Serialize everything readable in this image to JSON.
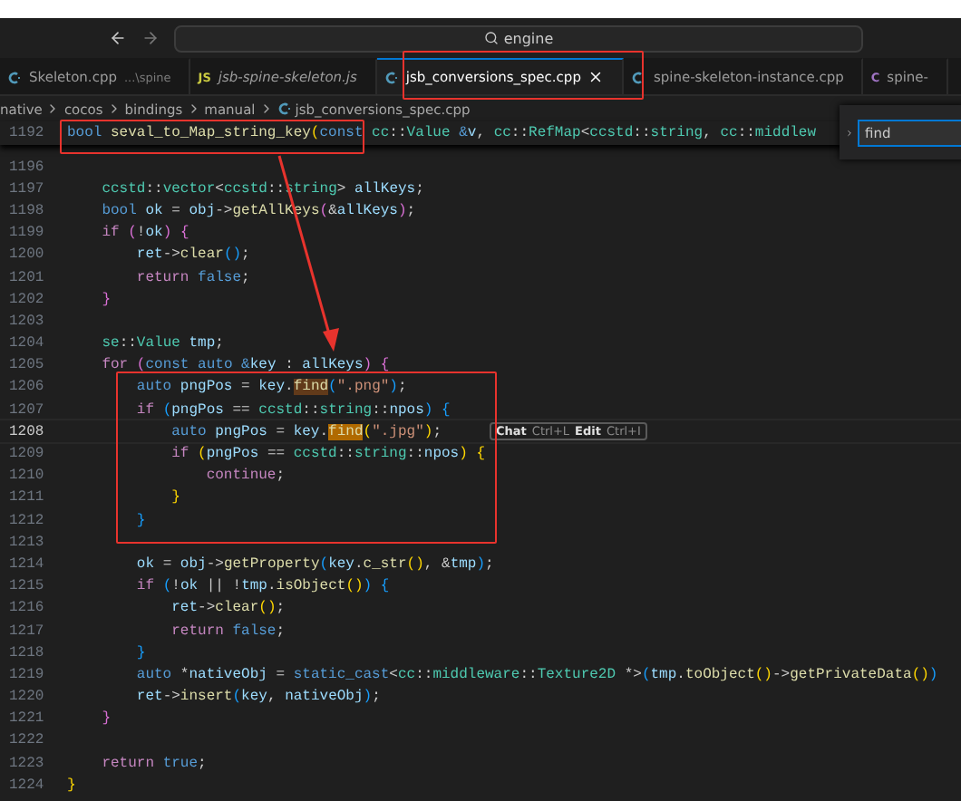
{
  "titlebar": {
    "search": "engine"
  },
  "tabs": [
    {
      "label": "Skeleton.cpp",
      "description": "...\\spine",
      "kind": "cpp",
      "selected": false,
      "italic": false
    },
    {
      "label": "jsb-spine-skeleton.js",
      "kind": "js",
      "badge": "JS",
      "selected": false,
      "italic": true
    },
    {
      "label": "jsb_conversions_spec.cpp",
      "kind": "cpp",
      "selected": true,
      "italic": false
    },
    {
      "label": "spine-skeleton-instance.cpp",
      "kind": "cpp",
      "selected": false,
      "italic": false
    },
    {
      "label": "spine-",
      "kind": "c",
      "badge": "C",
      "selected": false,
      "italic": false
    }
  ],
  "breadcrumb": [
    "native",
    "cocos",
    "bindings",
    "manual",
    "jsb_conversions_spec.cpp"
  ],
  "sticky_line": {
    "number": "1192",
    "tokens": [
      {
        "text": "bool",
        "kind": "k"
      },
      {
        "text": " seval_to_Map_string_key",
        "kind": "f"
      },
      {
        "text": "(",
        "kind": "y"
      },
      {
        "text": "const",
        "kind": "k"
      },
      {
        "text": " cc",
        "kind": "t"
      },
      {
        "text": "::",
        "kind": "p"
      },
      {
        "text": "Value",
        "kind": "t"
      },
      {
        "text": " &",
        "kind": "k"
      },
      {
        "text": "v",
        "kind": "v"
      },
      {
        "text": ", ",
        "kind": "p"
      },
      {
        "text": "cc",
        "kind": "t"
      },
      {
        "text": "::",
        "kind": "p"
      },
      {
        "text": "RefMap",
        "kind": "t"
      },
      {
        "text": "<",
        "kind": "p"
      },
      {
        "text": "ccstd",
        "kind": "t"
      },
      {
        "text": "::",
        "kind": "p"
      },
      {
        "text": "string",
        "kind": "t"
      },
      {
        "text": ", ",
        "kind": "p"
      },
      {
        "text": "cc",
        "kind": "t"
      },
      {
        "text": "::",
        "kind": "p"
      },
      {
        "text": "middlew",
        "kind": "t"
      }
    ]
  },
  "find_widget": {
    "value": "find"
  },
  "lines": [
    {
      "number": "1196",
      "current": false
    },
    {
      "number": "1197",
      "current": false,
      "tokens": [
        {
          "text": "    ccstd",
          "kind": "t"
        },
        {
          "text": "::",
          "kind": "p"
        },
        {
          "text": "vector",
          "kind": "t"
        },
        {
          "text": "<",
          "kind": "p"
        },
        {
          "text": "ccstd",
          "kind": "t"
        },
        {
          "text": "::",
          "kind": "p"
        },
        {
          "text": "string",
          "kind": "t"
        },
        {
          "text": "> ",
          "kind": "p"
        },
        {
          "text": "allKeys",
          "kind": "v"
        },
        {
          "text": ";",
          "kind": "p"
        }
      ]
    },
    {
      "number": "1198",
      "current": false,
      "tokens": [
        {
          "text": "    bool",
          "kind": "k"
        },
        {
          "text": " ok",
          "kind": "v"
        },
        {
          "text": " = ",
          "kind": "p"
        },
        {
          "text": "obj",
          "kind": "v"
        },
        {
          "text": "->",
          "kind": "p"
        },
        {
          "text": "getAllKeys",
          "kind": "f"
        },
        {
          "text": "(",
          "kind": "m"
        },
        {
          "text": "&",
          "kind": "p"
        },
        {
          "text": "allKeys",
          "kind": "v"
        },
        {
          "text": ")",
          "kind": "m"
        },
        {
          "text": ";",
          "kind": "p"
        }
      ]
    },
    {
      "number": "1199",
      "current": false,
      "tokens": [
        {
          "text": "    if",
          "kind": "c"
        },
        {
          "text": " (",
          "kind": "m"
        },
        {
          "text": "!",
          "kind": "p"
        },
        {
          "text": "ok",
          "kind": "v"
        },
        {
          "text": ")",
          "kind": "m"
        },
        {
          "text": " {",
          "kind": "m"
        }
      ]
    },
    {
      "number": "1200",
      "current": false,
      "tokens": [
        {
          "text": "        ret",
          "kind": "v"
        },
        {
          "text": "->",
          "kind": "p"
        },
        {
          "text": "clear",
          "kind": "f"
        },
        {
          "text": "()",
          "kind": "b"
        },
        {
          "text": ";",
          "kind": "p"
        }
      ]
    },
    {
      "number": "1201",
      "current": false,
      "tokens": [
        {
          "text": "        return",
          "kind": "c"
        },
        {
          "text": " false",
          "kind": "k"
        },
        {
          "text": ";",
          "kind": "p"
        }
      ]
    },
    {
      "number": "1202",
      "current": false,
      "tokens": [
        {
          "text": "    }",
          "kind": "m"
        }
      ]
    },
    {
      "number": "1203",
      "current": false
    },
    {
      "number": "1204",
      "current": false,
      "tokens": [
        {
          "text": "    se",
          "kind": "t"
        },
        {
          "text": "::",
          "kind": "p"
        },
        {
          "text": "Value",
          "kind": "t"
        },
        {
          "text": " tmp",
          "kind": "v"
        },
        {
          "text": ";",
          "kind": "p"
        }
      ]
    },
    {
      "number": "1205",
      "current": false,
      "tokens": [
        {
          "text": "    for",
          "kind": "c"
        },
        {
          "text": " (",
          "kind": "m"
        },
        {
          "text": "const",
          "kind": "k"
        },
        {
          "text": " auto",
          "kind": "k"
        },
        {
          "text": " &",
          "kind": "k"
        },
        {
          "text": "key",
          "kind": "v"
        },
        {
          "text": " : ",
          "kind": "p"
        },
        {
          "text": "allKeys",
          "kind": "v"
        },
        {
          "text": ")",
          "kind": "m"
        },
        {
          "text": " {",
          "kind": "m"
        }
      ]
    },
    {
      "number": "1206",
      "current": false,
      "tokens": [
        {
          "text": "        auto",
          "kind": "k"
        },
        {
          "text": " pngPos",
          "kind": "v"
        },
        {
          "text": " = ",
          "kind": "p"
        },
        {
          "text": "key",
          "kind": "v"
        },
        {
          "text": ".",
          "kind": "p"
        },
        {
          "text": "find",
          "kind": "hm"
        },
        {
          "text": "(",
          "kind": "b"
        },
        {
          "text": "\".png\"",
          "kind": "s"
        },
        {
          "text": ")",
          "kind": "b"
        },
        {
          "text": ";",
          "kind": "p"
        }
      ]
    },
    {
      "number": "1207",
      "current": false,
      "tokens": [
        {
          "text": "        if",
          "kind": "c"
        },
        {
          "text": " (",
          "kind": "b"
        },
        {
          "text": "pngPos",
          "kind": "v"
        },
        {
          "text": " == ",
          "kind": "p"
        },
        {
          "text": "ccstd",
          "kind": "t"
        },
        {
          "text": "::",
          "kind": "p"
        },
        {
          "text": "string",
          "kind": "t"
        },
        {
          "text": "::",
          "kind": "p"
        },
        {
          "text": "npos",
          "kind": "v"
        },
        {
          "text": ")",
          "kind": "b"
        },
        {
          "text": " {",
          "kind": "b"
        }
      ]
    },
    {
      "number": "1208",
      "current": true,
      "hint": [
        {
          "text": "Chat",
          "bold": true
        },
        {
          "text": "Ctrl+L",
          "bold": false
        },
        {
          "text": "Edit",
          "bold": true
        },
        {
          "text": "Ctrl+I",
          "bold": false
        }
      ],
      "tokens": [
        {
          "text": "            auto",
          "kind": "k"
        },
        {
          "text": " pngPos",
          "kind": "v"
        },
        {
          "text": " = ",
          "kind": "p"
        },
        {
          "text": "key",
          "kind": "v"
        },
        {
          "text": ".",
          "kind": "p"
        },
        {
          "text": "find",
          "kind": "hc"
        },
        {
          "text": "(",
          "kind": "y"
        },
        {
          "text": "\".jpg\"",
          "kind": "s"
        },
        {
          "text": ")",
          "kind": "y"
        },
        {
          "text": ";",
          "kind": "p"
        }
      ]
    },
    {
      "number": "1209",
      "current": false,
      "tokens": [
        {
          "text": "            if",
          "kind": "c"
        },
        {
          "text": " (",
          "kind": "y"
        },
        {
          "text": "pngPos",
          "kind": "v"
        },
        {
          "text": " == ",
          "kind": "p"
        },
        {
          "text": "ccstd",
          "kind": "t"
        },
        {
          "text": "::",
          "kind": "p"
        },
        {
          "text": "string",
          "kind": "t"
        },
        {
          "text": "::",
          "kind": "p"
        },
        {
          "text": "npos",
          "kind": "v"
        },
        {
          "text": ")",
          "kind": "y"
        },
        {
          "text": " {",
          "kind": "y"
        }
      ]
    },
    {
      "number": "1210",
      "current": false,
      "tokens": [
        {
          "text": "                continue",
          "kind": "c"
        },
        {
          "text": ";",
          "kind": "p"
        }
      ]
    },
    {
      "number": "1211",
      "current": false,
      "tokens": [
        {
          "text": "            }",
          "kind": "y"
        }
      ]
    },
    {
      "number": "1212",
      "current": false,
      "tokens": [
        {
          "text": "        }",
          "kind": "b"
        }
      ]
    },
    {
      "number": "1213",
      "current": false
    },
    {
      "number": "1214",
      "current": false,
      "tokens": [
        {
          "text": "        ok",
          "kind": "v"
        },
        {
          "text": " = ",
          "kind": "p"
        },
        {
          "text": "obj",
          "kind": "v"
        },
        {
          "text": "->",
          "kind": "p"
        },
        {
          "text": "getProperty",
          "kind": "f"
        },
        {
          "text": "(",
          "kind": "b"
        },
        {
          "text": "key",
          "kind": "v"
        },
        {
          "text": ".",
          "kind": "p"
        },
        {
          "text": "c_str",
          "kind": "f"
        },
        {
          "text": "()",
          "kind": "y"
        },
        {
          "text": ", &",
          "kind": "p"
        },
        {
          "text": "tmp",
          "kind": "v"
        },
        {
          "text": ")",
          "kind": "b"
        },
        {
          "text": ";",
          "kind": "p"
        }
      ]
    },
    {
      "number": "1215",
      "current": false,
      "tokens": [
        {
          "text": "        if",
          "kind": "c"
        },
        {
          "text": " (",
          "kind": "b"
        },
        {
          "text": "!",
          "kind": "p"
        },
        {
          "text": "ok",
          "kind": "v"
        },
        {
          "text": " || !",
          "kind": "p"
        },
        {
          "text": "tmp",
          "kind": "v"
        },
        {
          "text": ".",
          "kind": "p"
        },
        {
          "text": "isObject",
          "kind": "f"
        },
        {
          "text": "()",
          "kind": "y"
        },
        {
          "text": ")",
          "kind": "b"
        },
        {
          "text": " {",
          "kind": "b"
        }
      ]
    },
    {
      "number": "1216",
      "current": false,
      "tokens": [
        {
          "text": "            ret",
          "kind": "v"
        },
        {
          "text": "->",
          "kind": "p"
        },
        {
          "text": "clear",
          "kind": "f"
        },
        {
          "text": "()",
          "kind": "y"
        },
        {
          "text": ";",
          "kind": "p"
        }
      ]
    },
    {
      "number": "1217",
      "current": false,
      "tokens": [
        {
          "text": "            return",
          "kind": "c"
        },
        {
          "text": " false",
          "kind": "k"
        },
        {
          "text": ";",
          "kind": "p"
        }
      ]
    },
    {
      "number": "1218",
      "current": false,
      "tokens": [
        {
          "text": "        }",
          "kind": "b"
        }
      ]
    },
    {
      "number": "1219",
      "current": false,
      "tokens": [
        {
          "text": "        auto",
          "kind": "k"
        },
        {
          "text": " *",
          "kind": "p"
        },
        {
          "text": "nativeObj",
          "kind": "v"
        },
        {
          "text": " = ",
          "kind": "p"
        },
        {
          "text": "static_cast",
          "kind": "k"
        },
        {
          "text": "<",
          "kind": "p"
        },
        {
          "text": "cc",
          "kind": "t"
        },
        {
          "text": "::",
          "kind": "p"
        },
        {
          "text": "middleware",
          "kind": "t"
        },
        {
          "text": "::",
          "kind": "p"
        },
        {
          "text": "Texture2D",
          "kind": "t"
        },
        {
          "text": " *>",
          "kind": "p"
        },
        {
          "text": "(",
          "kind": "b"
        },
        {
          "text": "tmp",
          "kind": "v"
        },
        {
          "text": ".",
          "kind": "p"
        },
        {
          "text": "toObject",
          "kind": "f"
        },
        {
          "text": "()",
          "kind": "y"
        },
        {
          "text": "->",
          "kind": "p"
        },
        {
          "text": "getPrivateData",
          "kind": "f"
        },
        {
          "text": "()",
          "kind": "y"
        },
        {
          "text": ")",
          "kind": "b"
        }
      ]
    },
    {
      "number": "1220",
      "current": false,
      "tokens": [
        {
          "text": "        ret",
          "kind": "v"
        },
        {
          "text": "->",
          "kind": "p"
        },
        {
          "text": "insert",
          "kind": "f"
        },
        {
          "text": "(",
          "kind": "b"
        },
        {
          "text": "key",
          "kind": "v"
        },
        {
          "text": ", ",
          "kind": "p"
        },
        {
          "text": "nativeObj",
          "kind": "v"
        },
        {
          "text": ")",
          "kind": "b"
        },
        {
          "text": ";",
          "kind": "p"
        }
      ]
    },
    {
      "number": "1221",
      "current": false,
      "tokens": [
        {
          "text": "    }",
          "kind": "m"
        }
      ]
    },
    {
      "number": "1222",
      "current": false
    },
    {
      "number": "1223",
      "current": false,
      "tokens": [
        {
          "text": "    return",
          "kind": "c"
        },
        {
          "text": " true",
          "kind": "k"
        },
        {
          "text": ";",
          "kind": "p"
        }
      ]
    },
    {
      "number": "1224",
      "current": false,
      "tokens": [
        {
          "text": "}",
          "kind": "y"
        }
      ]
    }
  ]
}
